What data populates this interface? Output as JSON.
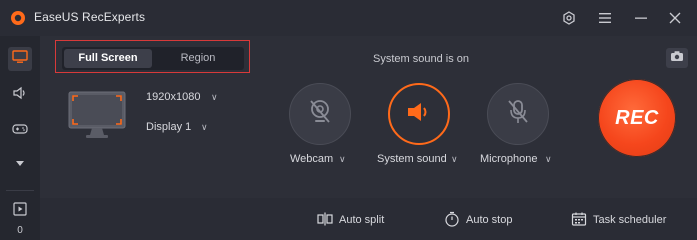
{
  "app": {
    "title": "EaseUS RecExperts",
    "logo_icon": "easeus-logo-icon",
    "accent_color": "#ff6a1a",
    "highlight_border_color": "#d83a3a"
  },
  "titlebar": {
    "icons": [
      "settings-icon",
      "menu-icon",
      "minimize-icon",
      "close-icon"
    ]
  },
  "sidebar": {
    "items": [
      {
        "icon": "screen-icon",
        "active": true
      },
      {
        "icon": "audio-icon",
        "active": false
      },
      {
        "icon": "gamepad-icon",
        "active": false
      },
      {
        "icon": "caret-down-icon",
        "active": false
      }
    ],
    "recordings": {
      "icon": "recordings-icon",
      "count": "0"
    }
  },
  "capture": {
    "modes": [
      "Full Screen",
      "Region"
    ],
    "selected_mode": "Full Screen",
    "resolution": "1920x1080",
    "display": "Display 1"
  },
  "sources": {
    "status_text": "System sound is on",
    "items": [
      {
        "label": "Webcam",
        "icon": "webcam-off-icon",
        "enabled": false
      },
      {
        "label": "System sound",
        "icon": "speaker-icon",
        "enabled": true
      },
      {
        "label": "Microphone",
        "icon": "microphone-off-icon",
        "enabled": false
      }
    ],
    "screenshot_icon": "camera-icon"
  },
  "rec_button": {
    "label": "REC"
  },
  "bottom_bar": {
    "items": [
      {
        "label": "Auto split",
        "icon": "auto-split-icon"
      },
      {
        "label": "Auto stop",
        "icon": "clock-icon"
      },
      {
        "label": "Task scheduler",
        "icon": "calendar-icon"
      }
    ]
  }
}
